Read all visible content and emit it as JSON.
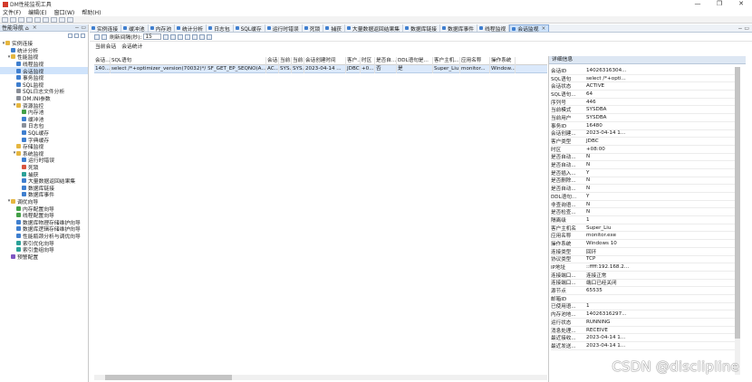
{
  "window": {
    "title": "DM性能监视工具",
    "controls": [
      "—",
      "❐",
      "✕"
    ]
  },
  "menu": [
    "文件(F)",
    "编辑(E)",
    "窗口(W)",
    "帮助(H)"
  ],
  "left_panel": {
    "tab_label": "性能导航 ⌂",
    "tree": [
      {
        "level": 0,
        "twisty": "▾",
        "icon": "folder",
        "label": "实例连接"
      },
      {
        "level": 1,
        "twisty": "",
        "icon": "blue",
        "label": "统计分析"
      },
      {
        "level": 1,
        "twisty": "▾",
        "icon": "folder",
        "label": "性能监视"
      },
      {
        "level": 2,
        "twisty": "",
        "icon": "blue",
        "label": "线程监视"
      },
      {
        "level": 2,
        "twisty": "",
        "icon": "blue",
        "label": "会话监视",
        "selected": true
      },
      {
        "level": 2,
        "twisty": "",
        "icon": "blue",
        "label": "事务监视"
      },
      {
        "level": 2,
        "twisty": "",
        "icon": "blue",
        "label": "SQL监视"
      },
      {
        "level": 2,
        "twisty": "",
        "icon": "gray",
        "label": "SQL日志文件分析"
      },
      {
        "level": 2,
        "twisty": "",
        "icon": "gray",
        "label": "DM.INI参数"
      },
      {
        "level": 2,
        "twisty": "▾",
        "icon": "folder",
        "label": "资源监控"
      },
      {
        "level": 3,
        "twisty": "",
        "icon": "green",
        "label": "内存池"
      },
      {
        "level": 3,
        "twisty": "",
        "icon": "blue",
        "label": "缓冲池"
      },
      {
        "level": 3,
        "twisty": "",
        "icon": "gray",
        "label": "日志包"
      },
      {
        "level": 3,
        "twisty": "",
        "icon": "blue",
        "label": "SQL缓存"
      },
      {
        "level": 3,
        "twisty": "",
        "icon": "blue",
        "label": "字典缓存"
      },
      {
        "level": 2,
        "twisty": "",
        "icon": "folder",
        "label": "存储监视"
      },
      {
        "level": 2,
        "twisty": "▾",
        "icon": "folder",
        "label": "系统监视"
      },
      {
        "level": 3,
        "twisty": "",
        "icon": "blue",
        "label": "运行时错误"
      },
      {
        "level": 3,
        "twisty": "",
        "icon": "red",
        "label": "死锁"
      },
      {
        "level": 3,
        "twisty": "",
        "icon": "teal",
        "label": "捕获"
      },
      {
        "level": 3,
        "twisty": "",
        "icon": "blue",
        "label": "大量数据返回结果集"
      },
      {
        "level": 3,
        "twisty": "",
        "icon": "blue",
        "label": "数据库链接"
      },
      {
        "level": 3,
        "twisty": "",
        "icon": "blue",
        "label": "数据库事件"
      },
      {
        "level": 1,
        "twisty": "▾",
        "icon": "folder",
        "label": "调优向导"
      },
      {
        "level": 2,
        "twisty": "",
        "icon": "green",
        "label": "内存配置向导"
      },
      {
        "level": 2,
        "twisty": "",
        "icon": "green",
        "label": "线程配置向导"
      },
      {
        "level": 2,
        "twisty": "",
        "icon": "blue",
        "label": "数据库物理存储维护向导"
      },
      {
        "level": 2,
        "twisty": "",
        "icon": "blue",
        "label": "数据库逻辑存储维护向导"
      },
      {
        "level": 2,
        "twisty": "",
        "icon": "blue",
        "label": "性能瓶颈分析与调优向导"
      },
      {
        "level": 2,
        "twisty": "",
        "icon": "teal",
        "label": "索引优化向导"
      },
      {
        "level": 2,
        "twisty": "",
        "icon": "teal",
        "label": "索引重组向导"
      },
      {
        "level": 1,
        "twisty": "",
        "icon": "purple",
        "label": "预警配置"
      }
    ]
  },
  "main_tabs": [
    {
      "label": "实例连接",
      "active": false
    },
    {
      "label": "缓冲池",
      "active": false
    },
    {
      "label": "内存池",
      "active": false
    },
    {
      "label": "统计分析",
      "active": false
    },
    {
      "label": "日志包",
      "active": false
    },
    {
      "label": "SQL缓存",
      "active": false
    },
    {
      "label": "运行时错误",
      "active": false
    },
    {
      "label": "死锁",
      "active": false
    },
    {
      "label": "捕获",
      "active": false
    },
    {
      "label": "大量数据返回结果集",
      "active": false
    },
    {
      "label": "数据库链接",
      "active": false
    },
    {
      "label": "数据库事件",
      "active": false
    },
    {
      "label": "线程监视",
      "active": false
    },
    {
      "label": "会话监视",
      "active": true
    }
  ],
  "subtoolbar": {
    "refresh_label": "刷新间隔(秒):",
    "refresh_value": "15"
  },
  "subtabs": [
    "当前会话",
    "会话统计"
  ],
  "table": {
    "headers": [
      "会话...",
      "SQL语句",
      "会话...",
      "当前...",
      "当前...",
      "会话创建时间",
      "客户...",
      "时区",
      "是否自...",
      "DDL语句是...",
      "客户主机...",
      "应用名称",
      "操作系统"
    ],
    "rows": [
      [
        "140...",
        "select /*+optimizer_version(70032)*/ SF_GET_EP_SEQNO(A...",
        "AC...",
        "SYS...",
        "SYS...",
        "2023-04-14 ...",
        "JDBC",
        "+0...",
        "否",
        "是",
        "Super_Liu",
        "monitor...",
        "Window..."
      ]
    ]
  },
  "detail": {
    "title": "详细信息",
    "items": [
      [
        "会话ID",
        "14026316304..."
      ],
      [
        "SQL语句",
        "select /*+opti..."
      ],
      [
        "会话状态",
        "ACTIVE"
      ],
      [
        "SQL语句...",
        "64"
      ],
      [
        "序列号",
        "446"
      ],
      [
        "当前模式",
        "SYSDBA"
      ],
      [
        "当前用户",
        "SYSDBA"
      ],
      [
        "事务ID",
        "16480"
      ],
      [
        "会话创建...",
        "2023-04-14 1..."
      ],
      [
        "客户类型",
        "JDBC"
      ],
      [
        "时区",
        "+08:00"
      ],
      [
        "是否自动...",
        "N"
      ],
      [
        "是否自动...",
        "N"
      ],
      [
        "是否插入...",
        "Y"
      ],
      [
        "是否删除...",
        "N"
      ],
      [
        "是否自动...",
        "N"
      ],
      [
        "DDL语句...",
        "Y"
      ],
      [
        "非查询语...",
        "N"
      ],
      [
        "是否检查...",
        "N"
      ],
      [
        "隔离级",
        "1"
      ],
      [
        "客户主机名",
        "Super_Liu"
      ],
      [
        "应用名称",
        "monitor.exe"
      ],
      [
        "操作系统",
        "Windows 10"
      ],
      [
        "连接类型",
        "回环"
      ],
      [
        "协议类型",
        "TCP"
      ],
      [
        "IP地址",
        "::ffff:192.168.2..."
      ],
      [
        "连接端口...",
        "连接正常"
      ],
      [
        "连接端口...",
        "端口已经关闭"
      ],
      [
        "源节点",
        "65535"
      ],
      [
        "邮箱ID",
        ""
      ],
      [
        "已使用语...",
        "1"
      ],
      [
        "内存池地...",
        "14026316297..."
      ],
      [
        "运行状态",
        "RUNNING"
      ],
      [
        "消息处理...",
        "RECEIVE"
      ],
      [
        "最近接收...",
        "2023-04-14 1..."
      ],
      [
        "最近发送...",
        "2023-04-14 1..."
      ]
    ]
  },
  "watermark": "CSDN @disclipline",
  "colors": {
    "selection": "#cfe3fb",
    "row_highlight": "#dbe9fb",
    "tab_active": "#cde2fa",
    "panel_header": "#dde7f3"
  }
}
